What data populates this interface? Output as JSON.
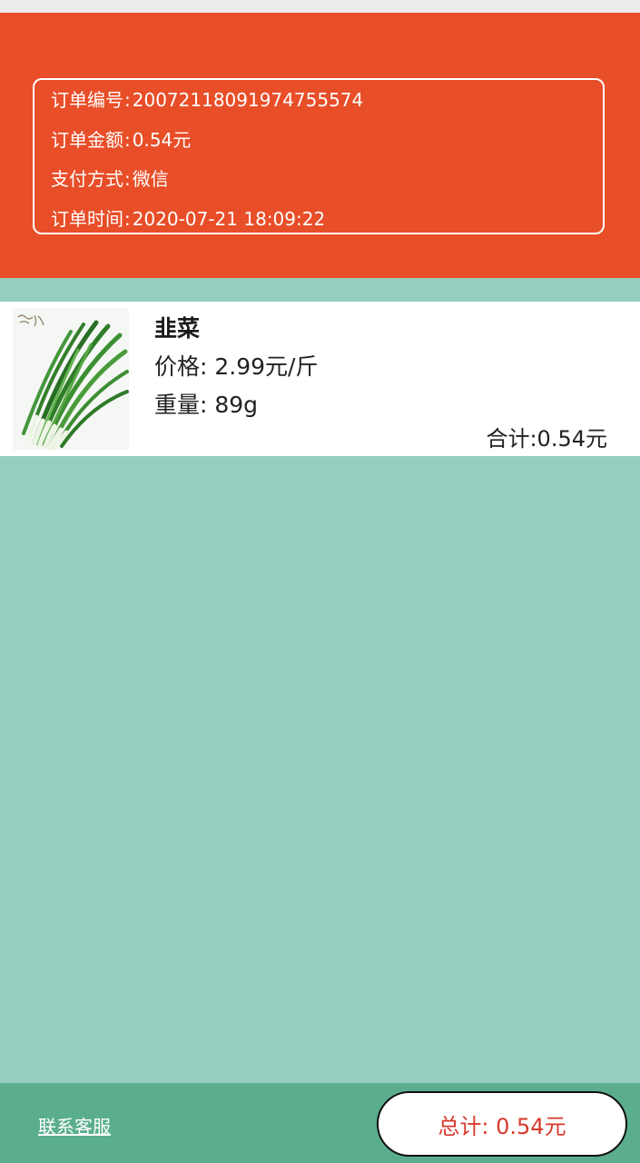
{
  "order": {
    "number_label": "订单编号",
    "number": "20072118091974755574",
    "amount_label": "订单金额",
    "amount": "0.54元",
    "payment_label": "支付方式",
    "payment": "微信",
    "time_label": "订单时间",
    "time": "2020-07-21 18:09:22"
  },
  "product": {
    "image_icon": "chinese-chives-photo",
    "name": "韭菜",
    "price_text": "价格: 2.99元/斤",
    "weight_text": "重量: 89g",
    "subtotal_text": "合计:0.54元"
  },
  "footer": {
    "contact_label": "联系客服",
    "total_text": "总计: 0.54元"
  },
  "colors": {
    "header": "#e84e28",
    "background": "#95cdbf",
    "footer": "#5aae8d",
    "total_text": "#d83a2c"
  }
}
